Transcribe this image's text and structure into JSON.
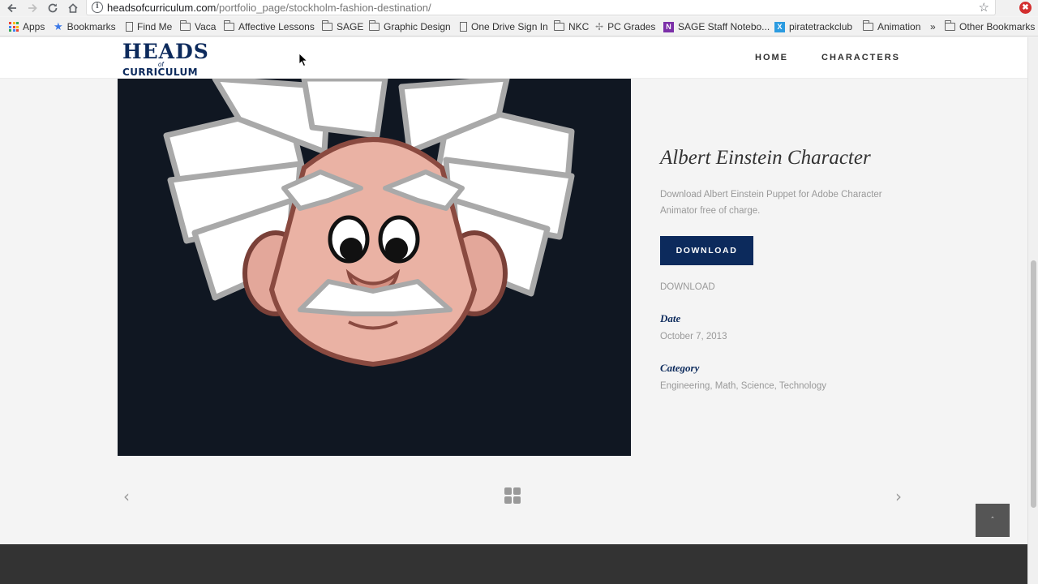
{
  "browser": {
    "url_host": "headsofcurriculum.com",
    "url_path": "/portfolio_page/stockholm-fashion-destination/",
    "info_glyph": "i",
    "star_glyph": "☆",
    "ext_glyph": "✖",
    "bookmarks": [
      {
        "label": "Apps",
        "icon": "apps-icon"
      },
      {
        "label": "Bookmarks",
        "icon": "star-icon"
      },
      {
        "label": "Find Me",
        "icon": "page-icon"
      },
      {
        "label": "Vaca",
        "icon": "folder-icon"
      },
      {
        "label": "Affective Lessons",
        "icon": "folder-icon"
      },
      {
        "label": "SAGE",
        "icon": "folder-icon"
      },
      {
        "label": "Graphic Design",
        "icon": "folder-icon"
      },
      {
        "label": "One Drive Sign In",
        "icon": "page-icon"
      },
      {
        "label": "NKC",
        "icon": "folder-icon"
      },
      {
        "label": "PC Grades",
        "icon": "sparkle-icon"
      },
      {
        "label": "SAGE Staff Notebo...",
        "icon": "onenote-icon"
      },
      {
        "label": "piratetrackclub",
        "icon": "excel-icon"
      },
      {
        "label": "Animation",
        "icon": "folder-icon"
      }
    ],
    "more_glyph": "»",
    "other_bookmarks": "Other Bookmarks"
  },
  "site": {
    "logo_top": "HEADS",
    "logo_of": "of",
    "logo_bottom": "CURRICULUM",
    "nav": [
      "HOME",
      "CHARACTERS"
    ]
  },
  "portfolio": {
    "title": "Albert Einstein Character",
    "description": "Download Albert Einstein Puppet for Adobe Character Animator free of charge.",
    "button_label": "DOWNLOAD",
    "link_label": "DOWNLOAD",
    "date_label": "Date",
    "date_value": "October 7, 2013",
    "category_label": "Category",
    "category_value": "Engineering, Math, Science, Technology"
  },
  "pager": {
    "prev_glyph": "‹",
    "next_glyph": "›",
    "to_top_glyph": "ˆ"
  },
  "colors": {
    "brand_navy": "#0c2a5c",
    "footer": "#333333",
    "hero_bg": "#101722"
  }
}
